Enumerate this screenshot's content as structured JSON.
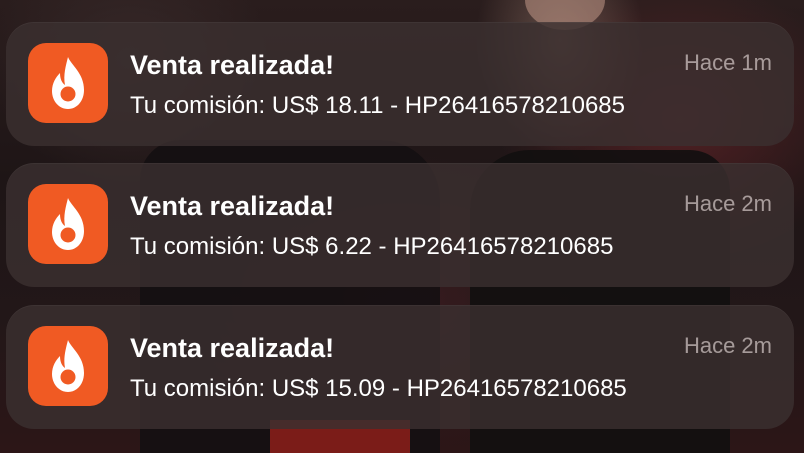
{
  "notifications": [
    {
      "app_icon": "hotmart-flame-icon",
      "title": "Venta realizada!",
      "body": "Tu comisión: US$ 18.11 - HP26416578210685",
      "time": "Hace 1m"
    },
    {
      "app_icon": "hotmart-flame-icon",
      "title": "Venta realizada!",
      "body": "Tu comisión: US$ 6.22 - HP26416578210685",
      "time": "Hace 2m"
    },
    {
      "app_icon": "hotmart-flame-icon",
      "title": "Venta realizada!",
      "body": "Tu comisión: US$ 15.09 - HP26416578210685",
      "time": "Hace 2m"
    }
  ],
  "colors": {
    "app_icon_bg": "#f05a23",
    "card_bg": "#3a302f",
    "text": "#ffffff"
  }
}
